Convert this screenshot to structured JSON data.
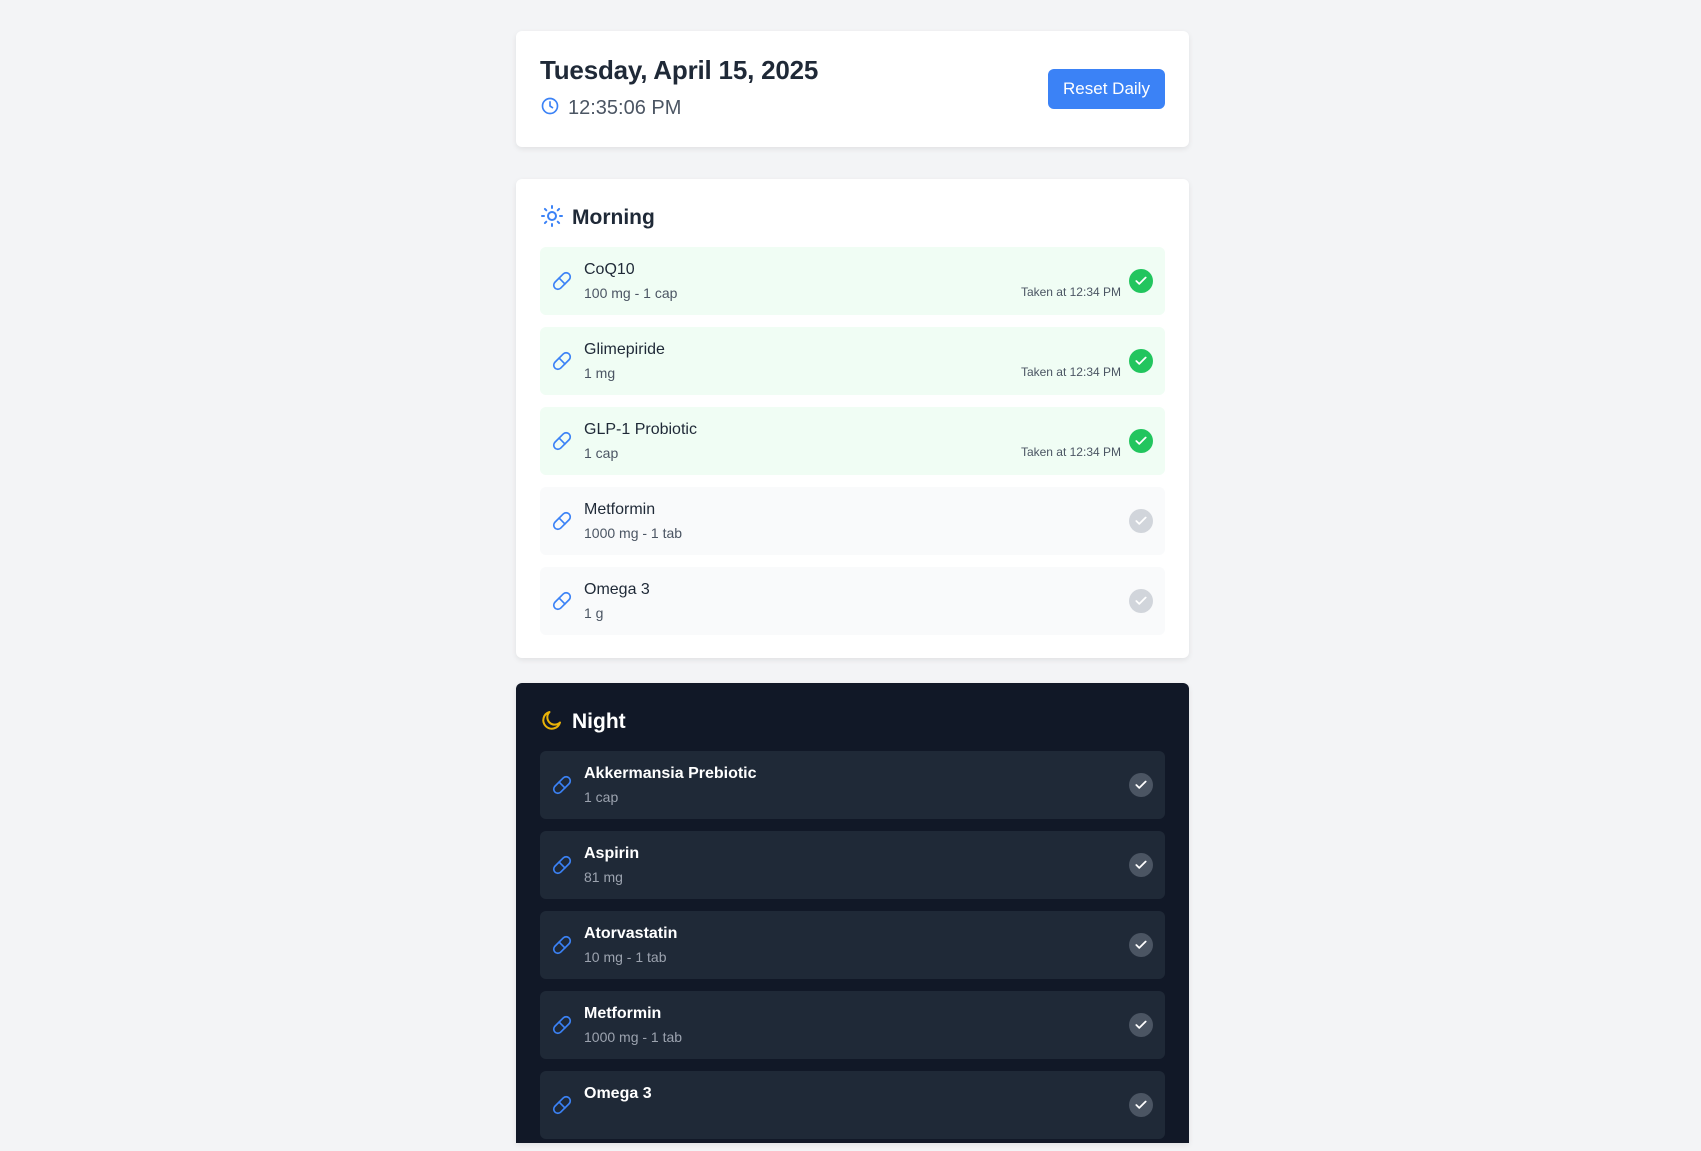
{
  "header": {
    "date": "Tuesday, April 15, 2025",
    "time": "12:35:06 PM",
    "reset_label": "Reset Daily"
  },
  "colors": {
    "accent": "#3b82f6",
    "taken_green": "#22c55e",
    "night_bg": "#111827",
    "moon_yellow": "#eab308"
  },
  "morning": {
    "title": "Morning",
    "icon": "sun-icon",
    "items": [
      {
        "name": "CoQ10",
        "dose": "100 mg - 1 cap",
        "taken": true,
        "taken_at": "Taken at 12:34 PM"
      },
      {
        "name": "Glimepiride",
        "dose": "1 mg",
        "taken": true,
        "taken_at": "Taken at 12:34 PM"
      },
      {
        "name": "GLP-1 Probiotic",
        "dose": "1 cap",
        "taken": true,
        "taken_at": "Taken at 12:34 PM"
      },
      {
        "name": "Metformin",
        "dose": "1000 mg - 1 tab",
        "taken": false,
        "taken_at": ""
      },
      {
        "name": "Omega 3",
        "dose": "1 g",
        "taken": false,
        "taken_at": ""
      }
    ]
  },
  "night": {
    "title": "Night",
    "icon": "moon-icon",
    "items": [
      {
        "name": "Akkermansia Prebiotic",
        "dose": "1 cap",
        "taken": false,
        "taken_at": ""
      },
      {
        "name": "Aspirin",
        "dose": "81 mg",
        "taken": false,
        "taken_at": ""
      },
      {
        "name": "Atorvastatin",
        "dose": "10 mg - 1 tab",
        "taken": false,
        "taken_at": ""
      },
      {
        "name": "Metformin",
        "dose": "1000 mg - 1 tab",
        "taken": false,
        "taken_at": ""
      },
      {
        "name": "Omega 3",
        "dose": "",
        "taken": false,
        "taken_at": ""
      }
    ]
  }
}
